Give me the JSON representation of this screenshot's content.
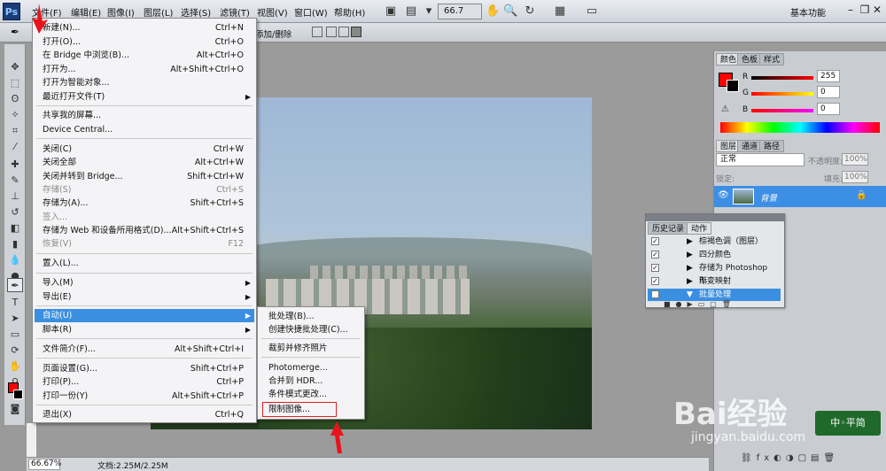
{
  "menubar": {
    "logo": "Ps",
    "items": [
      "文件(F)",
      "编辑(E)",
      "图像(I)",
      "图层(L)",
      "选择(S)",
      "滤镜(T)",
      "视图(V)",
      "窗口(W)",
      "帮助(H)"
    ],
    "zoom": "66.7",
    "workspace": "基本功能"
  },
  "optbar": {
    "mode_label": "添加/删除"
  },
  "file_menu": {
    "items": [
      {
        "label": "新建(N)...",
        "shortcut": "Ctrl+N"
      },
      {
        "label": "打开(O)...",
        "shortcut": "Ctrl+O"
      },
      {
        "label": "在 Bridge 中浏览(B)...",
        "shortcut": "Alt+Ctrl+O"
      },
      {
        "label": "打开为...",
        "shortcut": "Alt+Shift+Ctrl+O"
      },
      {
        "label": "打开为智能对象...",
        "shortcut": ""
      },
      {
        "label": "最近打开文件(T)",
        "shortcut": ""
      },
      {
        "label": "共享我的屏幕...",
        "shortcut": ""
      },
      {
        "label": "Device Central...",
        "shortcut": ""
      },
      {
        "label": "关闭(C)",
        "shortcut": "Ctrl+W"
      },
      {
        "label": "关闭全部",
        "shortcut": "Alt+Ctrl+W"
      },
      {
        "label": "关闭并转到 Bridge...",
        "shortcut": "Shift+Ctrl+W"
      },
      {
        "label": "存储(S)",
        "shortcut": "Ctrl+S"
      },
      {
        "label": "存储为(A)...",
        "shortcut": "Shift+Ctrl+S"
      },
      {
        "label": "签入...",
        "shortcut": ""
      },
      {
        "label": "存储为 Web 和设备所用格式(D)...",
        "shortcut": "Alt+Shift+Ctrl+S"
      },
      {
        "label": "恢复(V)",
        "shortcut": "F12"
      },
      {
        "label": "置入(L)...",
        "shortcut": ""
      },
      {
        "label": "导入(M)",
        "shortcut": ""
      },
      {
        "label": "导出(E)",
        "shortcut": ""
      },
      {
        "label": "自动(U)",
        "shortcut": ""
      },
      {
        "label": "脚本(R)",
        "shortcut": ""
      },
      {
        "label": "文件简介(F)...",
        "shortcut": "Alt+Shift+Ctrl+I"
      },
      {
        "label": "页面设置(G)...",
        "shortcut": "Shift+Ctrl+P"
      },
      {
        "label": "打印(P)...",
        "shortcut": "Ctrl+P"
      },
      {
        "label": "打印一份(Y)",
        "shortcut": "Alt+Shift+Ctrl+P"
      },
      {
        "label": "退出(X)",
        "shortcut": "Ctrl+Q"
      }
    ]
  },
  "auto_submenu": {
    "items": [
      "批处理(B)...",
      "创建快捷批处理(C)...",
      "裁剪并修齐照片",
      "Photomerge...",
      "合并到 HDR...",
      "条件模式更改...",
      "限制图像..."
    ]
  },
  "color_panel": {
    "tabs": [
      "颜色",
      "色板",
      "样式"
    ],
    "r_label": "R",
    "g_label": "G",
    "b_label": "B",
    "r": "255",
    "g": "0",
    "b": "0",
    "colors": {
      "fg": "#ff0000",
      "bg": "#000000"
    }
  },
  "layers_panel": {
    "tabs": [
      "图层",
      "通道",
      "路径"
    ],
    "blend_mode": "正常",
    "opacity_label": "不透明度:",
    "opacity": "100%",
    "lock_label": "锁定:",
    "fill_label": "填充:",
    "fill": "100%",
    "layer_name": "背景"
  },
  "actions_panel": {
    "tabs": [
      "历史记录",
      "动作"
    ],
    "rows": [
      "棕褐色调（图层）",
      "四分颜色",
      "存储为 Photoshop P...",
      "渐变映射",
      "批量处理"
    ]
  },
  "status": {
    "zoom": "66.67%",
    "doc": "文档:2.25M/2.25M"
  },
  "watermark": {
    "brand": "Bai经验",
    "url": "jingyan.baidu.com",
    "stamp": "中◦平简"
  }
}
